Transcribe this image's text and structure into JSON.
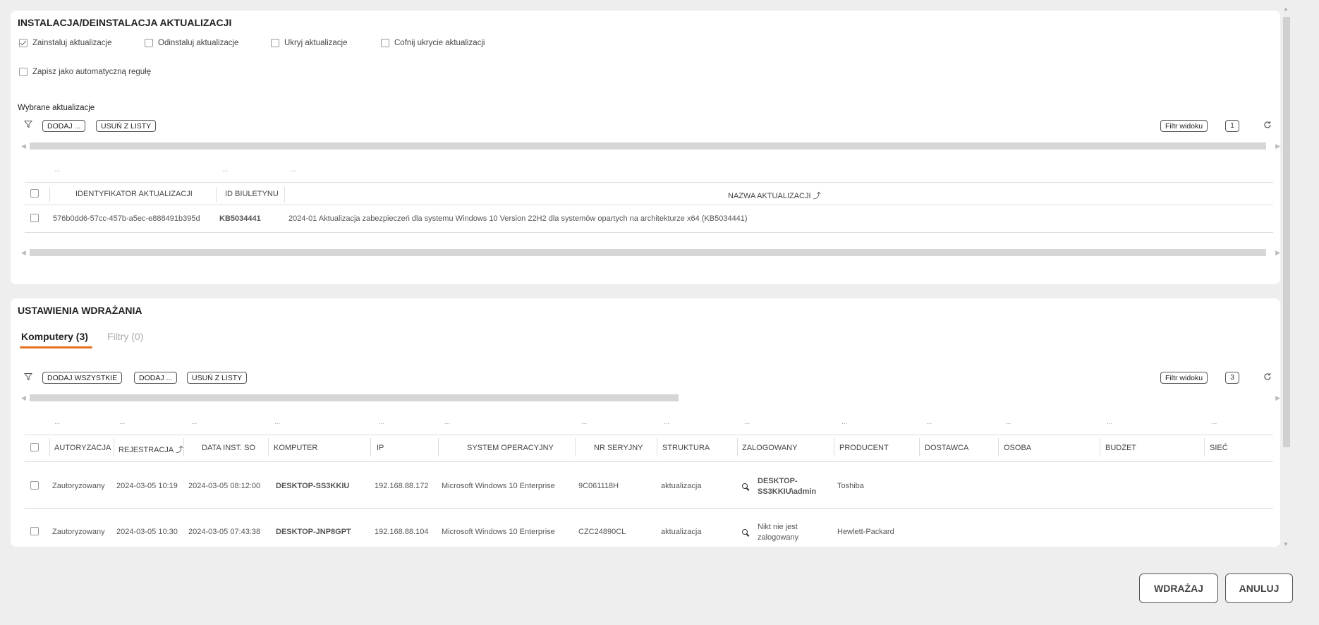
{
  "install_section": {
    "title": "INSTALACJA/DEINSTALACJA AKTUALIZACJI",
    "options": [
      {
        "label": "Zainstaluj aktualizacje",
        "checked": true
      },
      {
        "label": "Odinstaluj aktualizacje",
        "checked": false
      },
      {
        "label": "Ukryj aktualizacje",
        "checked": false
      },
      {
        "label": "Cofnij ukrycie aktualizacji",
        "checked": false
      }
    ],
    "save_rule": {
      "label": "Zapisz jako automatyczną regułę",
      "checked": false
    },
    "selected_label": "Wybrane aktualizacje",
    "toolbar": {
      "add": "DODAJ ...",
      "remove": "USUŃ Z LISTY",
      "view_filter": "Filtr widoku",
      "count": "1"
    },
    "filter_placeholders": [
      "...",
      "...",
      "..."
    ],
    "columns": [
      "IDENTYFIKATOR AKTUALIZACJI",
      "ID BIULETYNU",
      "NAZWA AKTUALIZACJI ⤴"
    ],
    "rows": [
      {
        "id": "576b0dd6-57cc-457b-a5ec-e888491b395d",
        "bulletin": "KB5034441",
        "name": "2024-01 Aktualizacja zabezpieczeń dla systemu Windows 10 Version 22H2 dla systemów opartych na architekturze x64 (KB5034441)"
      }
    ]
  },
  "deploy_section": {
    "title": "USTAWIENIA WDRAŻANIA",
    "tabs": [
      {
        "label": "Komputery (3)",
        "active": true
      },
      {
        "label": "Filtry (0)",
        "active": false
      }
    ],
    "toolbar": {
      "add_all": "DODAJ WSZYSTKIE",
      "add": "DODAJ ...",
      "remove": "USUŃ Z LISTY",
      "view_filter": "Filtr widoku",
      "count": "3"
    },
    "filter_placeholders": [
      "...",
      "...",
      "...",
      "...",
      "...",
      "...",
      "...",
      "...",
      "...",
      "...",
      "...",
      "...",
      "...",
      "..."
    ],
    "columns": [
      "AUTORYZACJA",
      "REJESTRACJA ⤴",
      "DATA INST. SO",
      "KOMPUTER",
      "IP",
      "SYSTEM OPERACYJNY",
      "NR SERYJNY",
      "STRUKTURA",
      "ZALOGOWANY",
      "PRODUCENT",
      "DOSTAWCA",
      "OSOBA",
      "BUDŻET",
      "SIEĆ"
    ],
    "rows": [
      {
        "auth": "Zautoryzowany",
        "reg": "2024-03-05 10:19",
        "inst": "2024-03-05 08:12:00",
        "computer": "DESKTOP-SS3KKIU",
        "ip": "192.168.88.172",
        "os": "Microsoft Windows 10 Enterprise",
        "serial": "9C061118H",
        "structure": "aktualizacja",
        "logged_line1": "DESKTOP-",
        "logged_line2": "SS3KKIU\\admin",
        "logged_is_link": true,
        "vendor": "Toshiba"
      },
      {
        "auth": "Zautoryzowany",
        "reg": "2024-03-05 10:30",
        "inst": "2024-03-05 07:43:38",
        "computer": "DESKTOP-JNP8GPT",
        "ip": "192.168.88.104",
        "os": "Microsoft Windows 10 Enterprise",
        "serial": "CZC24890CL",
        "structure": "aktualizacja",
        "logged_line1": "Nikt nie jest",
        "logged_line2": "zalogowany",
        "logged_is_link": false,
        "vendor": "Hewlett-Packard"
      }
    ]
  },
  "footer": {
    "deploy": "WDRAŻAJ",
    "cancel": "ANULUJ"
  },
  "colors": {
    "accent": "#e8711e",
    "background": "#eeeeee"
  }
}
